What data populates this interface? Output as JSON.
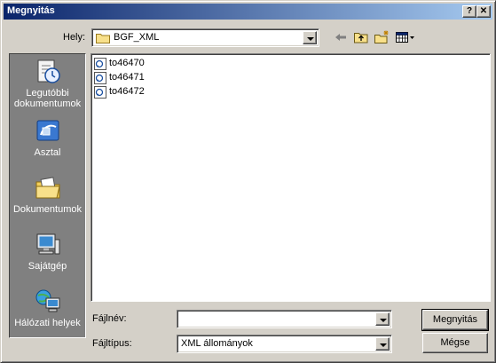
{
  "window": {
    "title": "Megnyitás",
    "help_glyph": "?",
    "close_glyph": "✕"
  },
  "location": {
    "label": "Hely:",
    "value": "BGF_XML"
  },
  "places": [
    {
      "label": "Legutóbbi dokumentumok",
      "icon": "recent-documents-icon"
    },
    {
      "label": "Asztal",
      "icon": "desktop-icon"
    },
    {
      "label": "Dokumentumok",
      "icon": "my-documents-icon"
    },
    {
      "label": "Sajátgép",
      "icon": "my-computer-icon"
    },
    {
      "label": "Hálózati helyek",
      "icon": "network-places-icon"
    }
  ],
  "files": [
    {
      "name": "to46470",
      "icon": "xml-file-icon"
    },
    {
      "name": "to46471",
      "icon": "xml-file-icon"
    },
    {
      "name": "to46472",
      "icon": "xml-file-icon"
    }
  ],
  "filename": {
    "label": "Fájlnév:",
    "value": ""
  },
  "filetype": {
    "label": "Fájltípus:",
    "value": "XML állományok"
  },
  "buttons": {
    "open": "Megnyitás",
    "cancel": "Mégse"
  }
}
